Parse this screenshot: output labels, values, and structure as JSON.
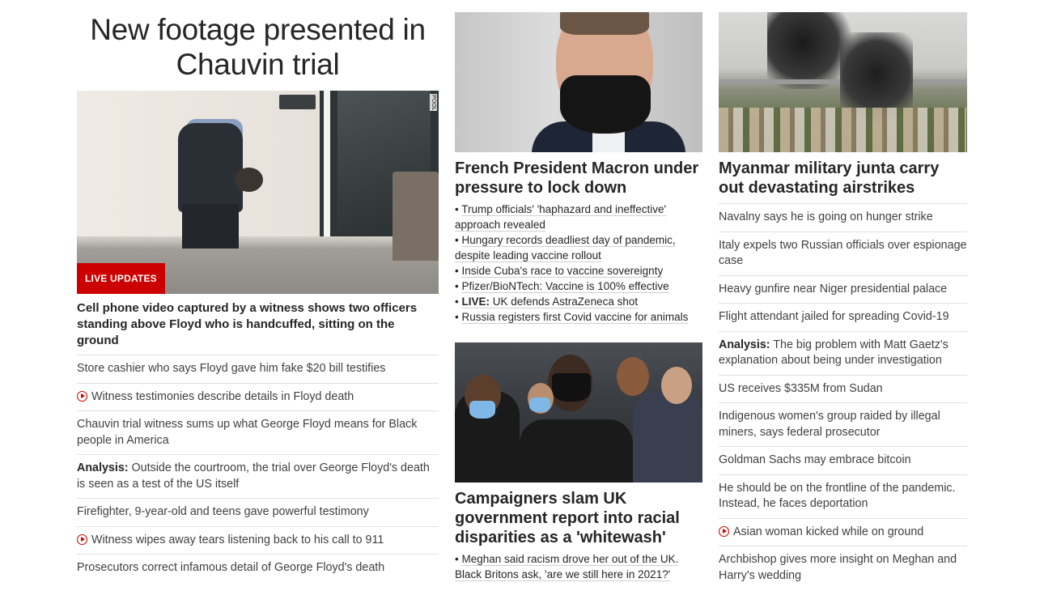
{
  "left": {
    "headline": "New footage presented in Chauvin trial",
    "image_credit": "POOL",
    "badge": "LIVE UPDATES",
    "caption": "Cell phone video captured by a witness shows two officers standing above Floyd who is handcuffed, sitting on the ground",
    "items": [
      {
        "prefix": "",
        "text": "Store cashier who says Floyd gave him fake $20 bill testifies",
        "video": false
      },
      {
        "prefix": "",
        "text": "Witness testimonies describe details in Floyd death",
        "video": true
      },
      {
        "prefix": "",
        "text": "Chauvin trial witness sums up what George Floyd means for Black people in America",
        "video": false
      },
      {
        "prefix": "Analysis:",
        "text": " Outside the courtroom, the trial over George Floyd's death is seen as a test of the US itself",
        "video": false
      },
      {
        "prefix": "",
        "text": "Firefighter, 9-year-old and teens gave powerful testimony",
        "video": false
      },
      {
        "prefix": "",
        "text": "Witness wipes away tears listening back to his call to 911",
        "video": true
      },
      {
        "prefix": "",
        "text": "Prosecutors correct infamous detail of George Floyd's death",
        "video": false
      }
    ]
  },
  "middle": {
    "story1": {
      "headline": "French President Macron under pressure to lock down",
      "bullets": [
        {
          "prefix": "",
          "text": "Trump officials' 'haphazard and ineffective' approach revealed"
        },
        {
          "prefix": "",
          "text": "Hungary records deadliest day of pandemic, despite leading vaccine rollout"
        },
        {
          "prefix": "",
          "text": "Inside Cuba's race to vaccine sovereignty"
        },
        {
          "prefix": "",
          "text": "Pfizer/BioNTech: Vaccine is 100% effective"
        },
        {
          "prefix": "LIVE:",
          "text": " UK defends AstraZeneca shot"
        },
        {
          "prefix": "",
          "text": "Russia registers first Covid vaccine for animals"
        }
      ]
    },
    "story2": {
      "headline": "Campaigners slam UK government report into racial disparities as a 'whitewash'",
      "bullets": [
        {
          "prefix": "",
          "text": "Meghan said racism drove her out of the UK. Black Britons ask, 'are we still here in 2021?'"
        }
      ]
    }
  },
  "right": {
    "headline": "Myanmar military junta carry out devastating airstrikes",
    "items": [
      {
        "prefix": "",
        "text": "Navalny says he is going on hunger strike",
        "video": false
      },
      {
        "prefix": "",
        "text": "Italy expels two Russian officials over espionage case",
        "video": false
      },
      {
        "prefix": "",
        "text": "Heavy gunfire near Niger presidential palace",
        "video": false
      },
      {
        "prefix": "",
        "text": "Flight attendant jailed for spreading Covid-19",
        "video": false
      },
      {
        "prefix": "Analysis:",
        "text": " The big problem with Matt Gaetz's explanation about being under investigation",
        "video": false
      },
      {
        "prefix": "",
        "text": "US receives $335M from Sudan",
        "video": false
      },
      {
        "prefix": "",
        "text": "Indigenous women's group raided by illegal miners, says federal prosecutor",
        "video": false
      },
      {
        "prefix": "",
        "text": "Goldman Sachs may embrace bitcoin",
        "video": false
      },
      {
        "prefix": "",
        "text": "He should be on the frontline of the pandemic. Instead, he faces deportation",
        "video": false
      },
      {
        "prefix": "",
        "text": "Asian woman kicked while on ground",
        "video": true
      },
      {
        "prefix": "",
        "text": "Archbishop gives more insight on Meghan and Harry's wedding",
        "video": false
      }
    ]
  },
  "colors": {
    "accent": "#cc0000",
    "text": "#262626",
    "divider": "#e1e1e1"
  },
  "icons": {
    "video": "play-circle-icon"
  }
}
